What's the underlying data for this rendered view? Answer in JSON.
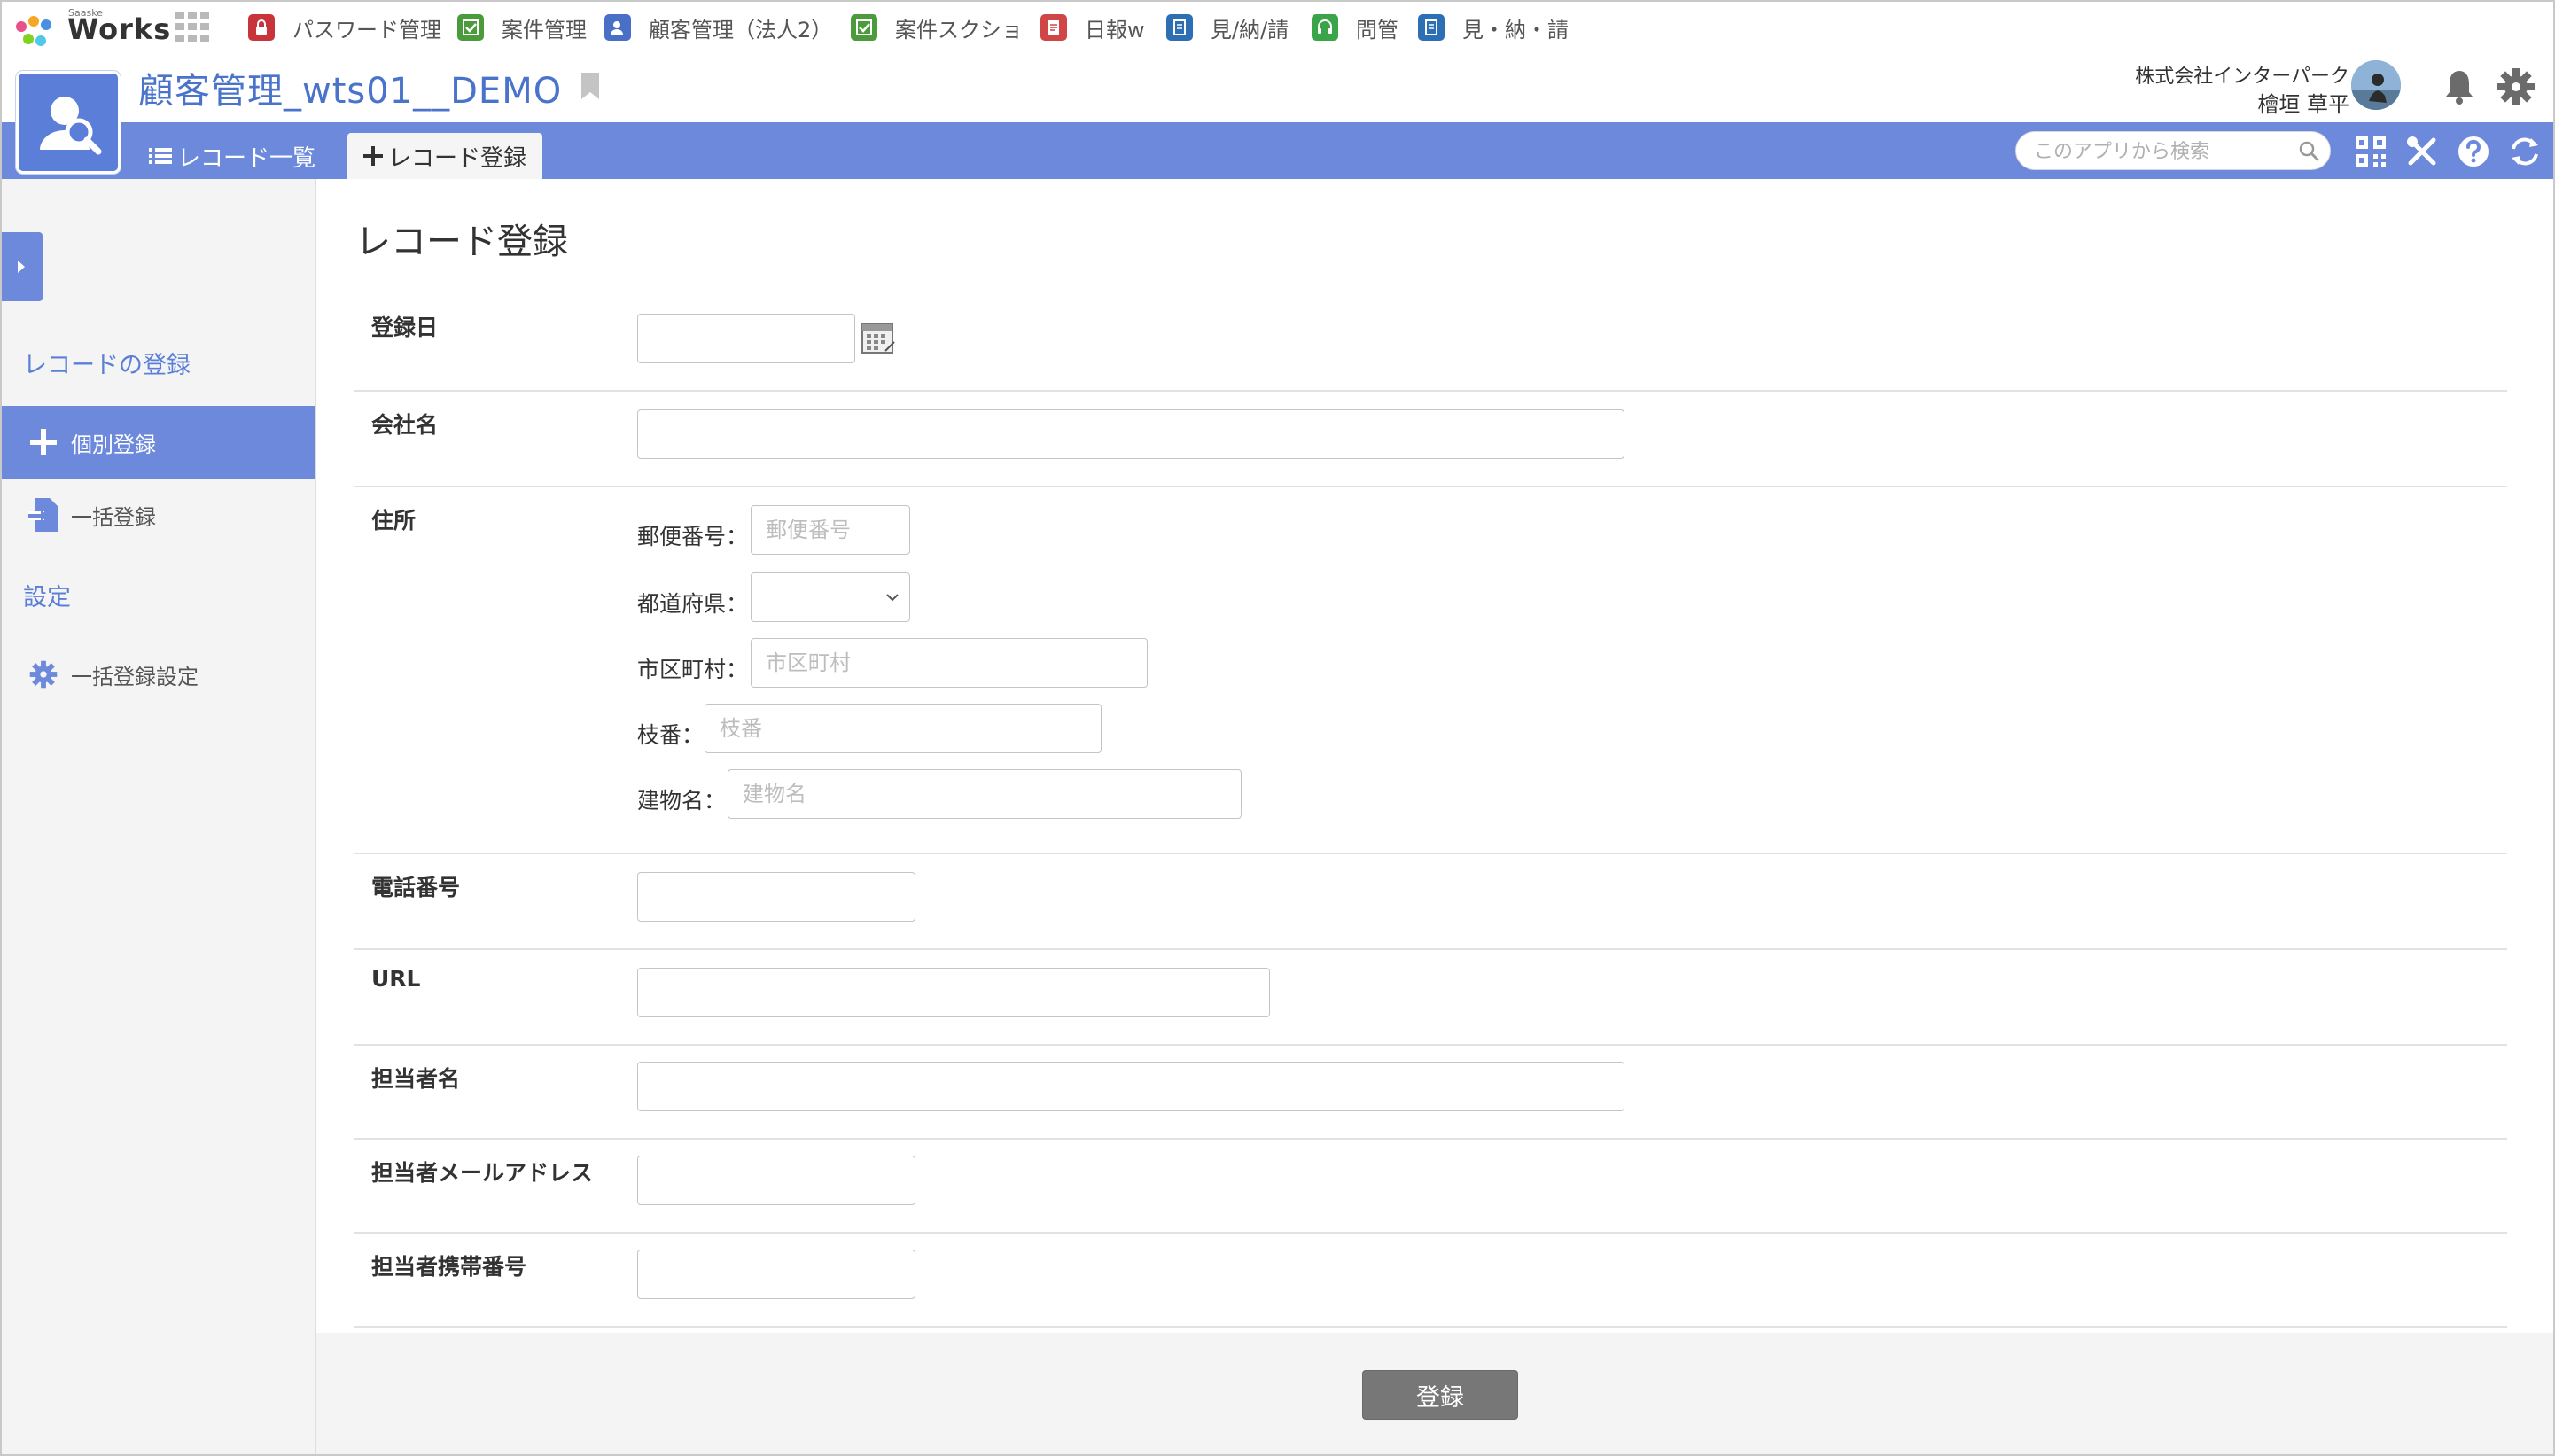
{
  "brand": {
    "small": "Saaske",
    "name": "Works"
  },
  "app_shortcuts": [
    {
      "label": "パスワード管理",
      "icon": "lock-icon",
      "color": "#c9333a"
    },
    {
      "label": "案件管理",
      "icon": "check-icon",
      "color": "#4b9a3c"
    },
    {
      "label": "顧客管理（法人2）",
      "icon": "customer-icon",
      "color": "#4a6fc7"
    },
    {
      "label": "案件スクショ",
      "icon": "check-icon",
      "color": "#4b9a3c"
    },
    {
      "label": "日報w",
      "icon": "report-icon",
      "color": "#d04646"
    },
    {
      "label": "見/納/請",
      "icon": "document-icon",
      "color": "#2d6fb5"
    },
    {
      "label": "問管",
      "icon": "headset-icon",
      "color": "#3aa548"
    },
    {
      "label": "見・納・請",
      "icon": "document-icon",
      "color": "#2d6fb5"
    }
  ],
  "header": {
    "app_title": "顧客管理_wts01__DEMO",
    "company": "株式会社インターパーク",
    "user": "檜垣 草平"
  },
  "nav": {
    "tabs": [
      {
        "label": "レコード一覧"
      },
      {
        "label": "レコード登録"
      }
    ],
    "search_placeholder": "このアプリから検索"
  },
  "sidebar": {
    "section_records": "レコードの登録",
    "item_single": "個別登録",
    "item_bulk": "一括登録",
    "section_settings": "設定",
    "item_bulk_settings": "一括登録設定"
  },
  "form": {
    "page_title": "レコード登録",
    "registration_date": {
      "label": "登録日",
      "value": ""
    },
    "company_name": {
      "label": "会社名",
      "value": ""
    },
    "address": {
      "label": "住所",
      "postal_label": "郵便番号：",
      "postal_placeholder": "郵便番号",
      "prefecture_label": "都道府県：",
      "prefecture_value": "",
      "city_label": "市区町村：",
      "city_placeholder": "市区町村",
      "block_label": "枝番：",
      "block_placeholder": "枝番",
      "building_label": "建物名：",
      "building_placeholder": "建物名"
    },
    "phone": {
      "label": "電話番号",
      "value": ""
    },
    "url": {
      "label": "URL",
      "value": ""
    },
    "contact_name": {
      "label": "担当者名",
      "value": ""
    },
    "contact_email": {
      "label": "担当者メールアドレス",
      "value": ""
    },
    "contact_mobile": {
      "label": "担当者携帯番号",
      "value": ""
    },
    "submit_label": "登録"
  },
  "colors": {
    "accent": "#6c89db",
    "title": "#4a73cc",
    "submit": "#777777"
  }
}
